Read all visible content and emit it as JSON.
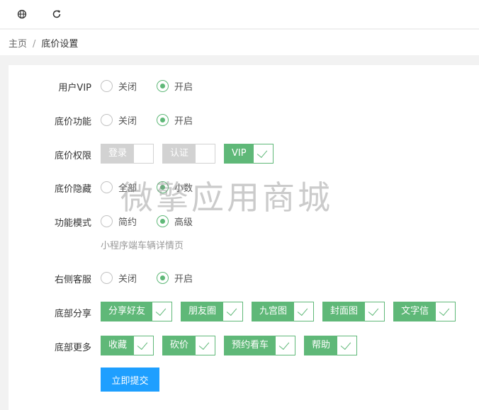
{
  "topbar": {
    "icons": [
      "globe-icon",
      "refresh-icon"
    ]
  },
  "breadcrumb": {
    "home": "主页",
    "separator": "/",
    "current": "底价设置"
  },
  "rows": {
    "vip": {
      "label": "用户VIP",
      "options": [
        "关闭",
        "开启"
      ],
      "selected": 1
    },
    "floor_func": {
      "label": "底价功能",
      "options": [
        "关闭",
        "开启"
      ],
      "selected": 1
    },
    "floor_perm": {
      "label": "底价权限",
      "checks": [
        {
          "label": "登录",
          "checked": false
        },
        {
          "label": "认证",
          "checked": false
        },
        {
          "label": "VIP",
          "checked": true
        }
      ]
    },
    "floor_hide": {
      "label": "底价隐藏",
      "options": [
        "全部",
        "小数"
      ],
      "selected": 1
    },
    "func_mode": {
      "label": "功能模式",
      "options": [
        "简约",
        "高级"
      ],
      "selected": 1,
      "hint": "小程序端车辆详情页"
    },
    "right_service": {
      "label": "右侧客服",
      "options": [
        "关闭",
        "开启"
      ],
      "selected": 1
    },
    "bottom_share": {
      "label": "底部分享",
      "checks": [
        {
          "label": "分享好友",
          "checked": true
        },
        {
          "label": "朋友圈",
          "checked": true
        },
        {
          "label": "九宫图",
          "checked": true
        },
        {
          "label": "封面图",
          "checked": true
        },
        {
          "label": "文字信",
          "checked": true
        }
      ]
    },
    "bottom_more": {
      "label": "底部更多",
      "checks": [
        {
          "label": "收藏",
          "checked": true
        },
        {
          "label": "砍价",
          "checked": true
        },
        {
          "label": "预约看车",
          "checked": true
        },
        {
          "label": "帮助",
          "checked": true
        }
      ]
    }
  },
  "submit_label": "立即提交",
  "watermark": "微擎应用商城",
  "colors": {
    "accent_green": "#5fb878",
    "primary_blue": "#1e9fff",
    "unchecked_gray": "#d2d2d2"
  }
}
